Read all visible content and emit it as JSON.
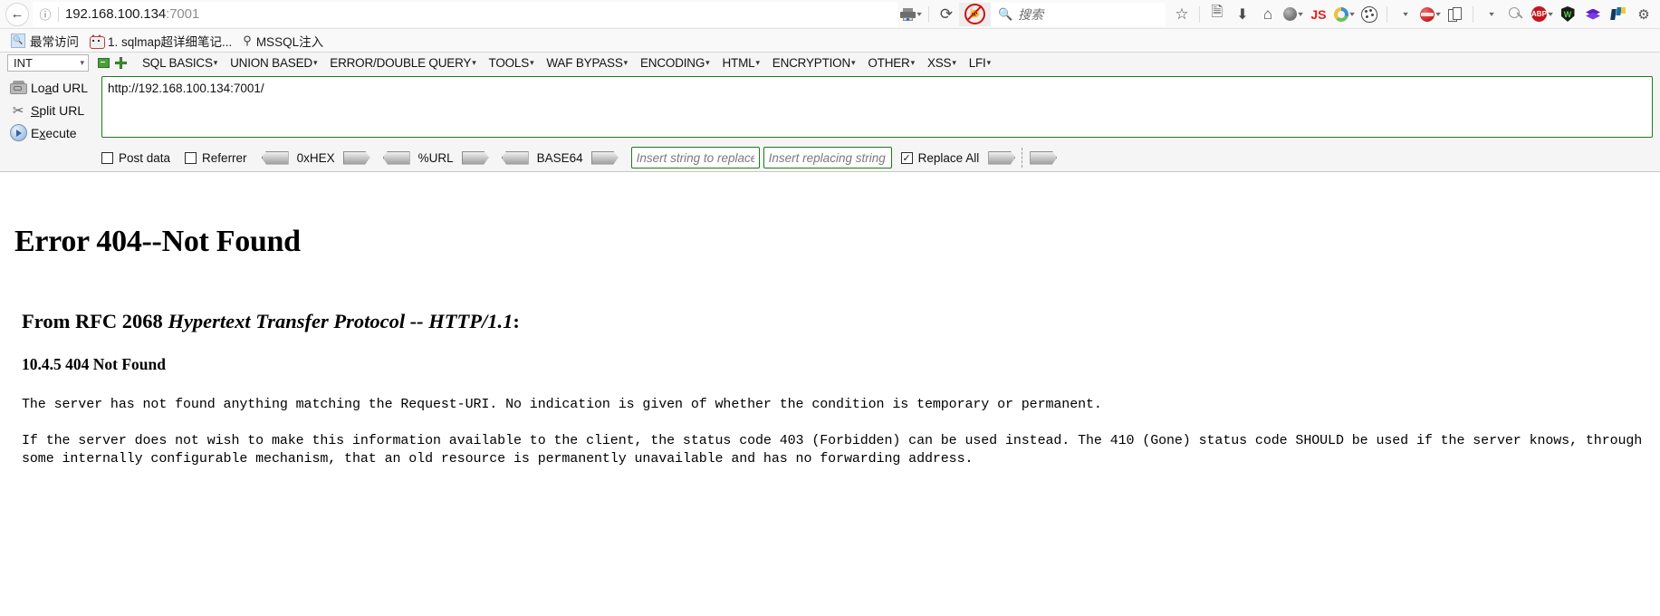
{
  "browser": {
    "back_icon": "back-arrow-icon",
    "identity_icon": "info-circle-icon",
    "url_host": "192.168.100.134",
    "url_port": ":7001",
    "reload_glyph": "⟳",
    "search_placeholder": "搜索",
    "toolbar_icons": [
      {
        "name": "printer-icon",
        "glyph": ""
      },
      {
        "name": "reload-icon",
        "glyph": "⟳"
      },
      {
        "name": "no-cat-blocker-icon",
        "glyph": ""
      },
      {
        "name": "search-icon",
        "glyph": "🔍"
      },
      {
        "name": "bookmark-star-icon",
        "glyph": "☆"
      },
      {
        "name": "reading-list-icon",
        "glyph": "▤"
      },
      {
        "name": "downloads-icon",
        "glyph": "⬇"
      },
      {
        "name": "home-icon",
        "glyph": "⌂"
      },
      {
        "name": "globe-account-icon",
        "glyph": ""
      },
      {
        "name": "javascript-toggle-icon",
        "glyph": "JS"
      },
      {
        "name": "chrome-ball-icon",
        "glyph": ""
      },
      {
        "name": "palette-icon",
        "glyph": ""
      },
      {
        "name": "red-sphere-icon",
        "glyph": ""
      },
      {
        "name": "copy-pages-icon",
        "glyph": ""
      },
      {
        "name": "magnifier-m-icon",
        "glyph": ""
      },
      {
        "name": "adblock-plus-icon",
        "glyph": "ABP"
      },
      {
        "name": "dark-shield-icon",
        "glyph": "W"
      },
      {
        "name": "purple-diamond-icon",
        "glyph": ""
      },
      {
        "name": "n-check-icon",
        "glyph": ""
      },
      {
        "name": "gear-icon",
        "glyph": "⚙"
      }
    ]
  },
  "bookmarks": [
    {
      "label": "最常访问",
      "icon": "most-visited-icon"
    },
    {
      "label": "1. sqlmap超详细笔记...",
      "icon": "cat-favicon"
    },
    {
      "label": "MSSQL注入",
      "icon": "pin-favicon"
    }
  ],
  "hackbar": {
    "type_select": "INT",
    "menu": [
      "SQL BASICS",
      "UNION BASED",
      "ERROR/DOUBLE QUERY",
      "TOOLS",
      "WAF BYPASS",
      "ENCODING",
      "HTML",
      "ENCRYPTION",
      "OTHER",
      "XSS",
      "LFI"
    ],
    "buttons": [
      {
        "label_pre": "Lo",
        "label_key": "a",
        "label_post": "d URL",
        "icon": "load-url-icon"
      },
      {
        "label_pre": "",
        "label_key": "S",
        "label_post": "plit URL",
        "icon": "split-url-icon"
      },
      {
        "label_pre": "E",
        "label_key": "x",
        "label_post": "ecute",
        "icon": "execute-icon"
      }
    ],
    "url_value": "http://192.168.100.134:7001/",
    "options": {
      "post_data_label": "Post data",
      "post_data_checked": false,
      "referrer_label": "Referrer",
      "referrer_checked": false,
      "hex_label": "0xHEX",
      "url_label": "%URL",
      "base64_label": "BASE64",
      "search_placeholder": "Insert string to replace",
      "search_value": "",
      "replace_placeholder": "Insert replacing string",
      "replace_value": "",
      "replace_all_label": "Replace All",
      "replace_all_checked": true,
      "checkmark": "✓"
    }
  },
  "content": {
    "title": "Error 404--Not Found",
    "rfc_prefix": "From RFC 2068 ",
    "rfc_italic": "Hypertext Transfer Protocol -- HTTP/1.1",
    "rfc_suffix": ":",
    "section": "10.4.5 404 Not Found",
    "paragraph1": "The server has not found anything matching the Request-URI. No indication is given of whether the condition is temporary or permanent.",
    "paragraph2": "If the server does not wish to make this information available to the client, the status code 403 (Forbidden) can be used instead. The 410 (Gone) status code SHOULD be used if the server knows, through some internally configurable mechanism, that an old resource is permanently unavailable and has no forwarding address."
  },
  "colors": {
    "hackbar_border_green": "#1d7a1d",
    "chrome_bg": "#f9f9fa",
    "hackbar_bg": "#f5f5f5"
  }
}
